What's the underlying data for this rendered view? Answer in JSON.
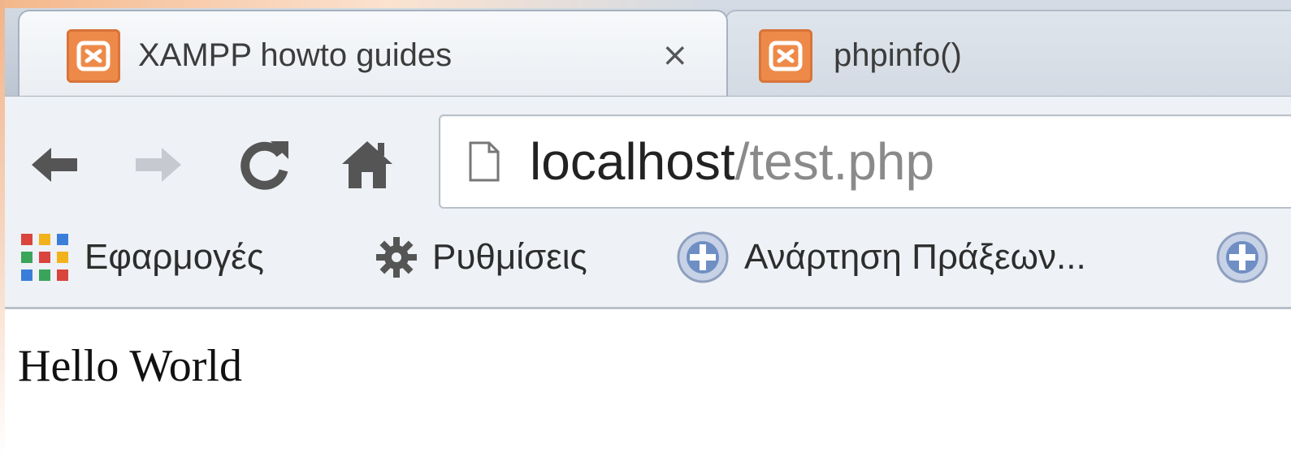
{
  "tabs": [
    {
      "label": "XAMPP howto guides",
      "close": "×",
      "active": true,
      "icon": "xampp-icon"
    },
    {
      "label": "phpinfo()",
      "active": false,
      "icon": "xampp-icon"
    }
  ],
  "toolbar": {
    "back_icon": "arrow-left-icon",
    "forward_icon": "arrow-right-icon",
    "reload_icon": "reload-icon",
    "home_icon": "home-icon"
  },
  "address_bar": {
    "host": "localhost",
    "path": "/test.php"
  },
  "bookmarks": [
    {
      "label": "Εφαρμογές",
      "icon": "apps-grid-icon"
    },
    {
      "label": "Ρυθμίσεις",
      "icon": "gear-icon"
    },
    {
      "label": "Ανάρτηση Πράξεων...",
      "icon": "greek-emblem-icon"
    }
  ],
  "page": {
    "text": "Hello World"
  },
  "colors": {
    "xampp_orange": "#ee8a49",
    "chrome_frame": "#c9d1dc",
    "toolbar_bg": "#eef1f5"
  }
}
